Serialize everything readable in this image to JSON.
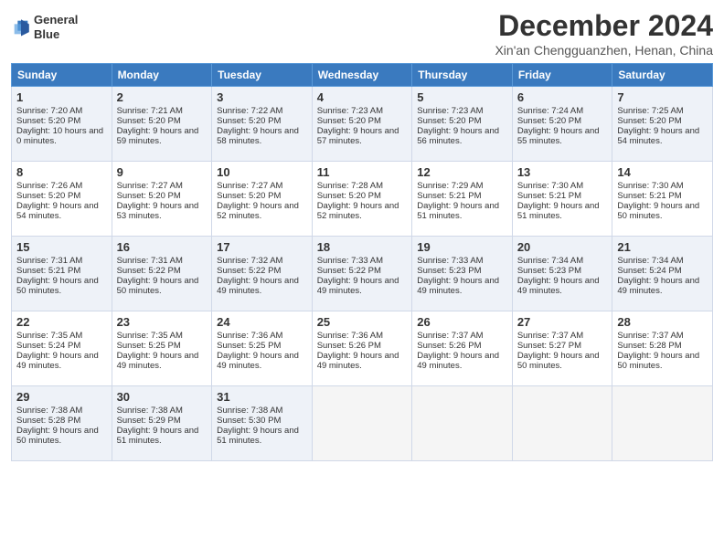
{
  "header": {
    "logo_line1": "General",
    "logo_line2": "Blue",
    "month": "December 2024",
    "location": "Xin'an Chengguanzhen, Henan, China"
  },
  "days_of_week": [
    "Sunday",
    "Monday",
    "Tuesday",
    "Wednesday",
    "Thursday",
    "Friday",
    "Saturday"
  ],
  "weeks": [
    [
      {
        "day": "1",
        "sunrise": "7:20 AM",
        "sunset": "5:20 PM",
        "daylight": "10 hours and 0 minutes."
      },
      {
        "day": "2",
        "sunrise": "7:21 AM",
        "sunset": "5:20 PM",
        "daylight": "9 hours and 59 minutes."
      },
      {
        "day": "3",
        "sunrise": "7:22 AM",
        "sunset": "5:20 PM",
        "daylight": "9 hours and 58 minutes."
      },
      {
        "day": "4",
        "sunrise": "7:23 AM",
        "sunset": "5:20 PM",
        "daylight": "9 hours and 57 minutes."
      },
      {
        "day": "5",
        "sunrise": "7:23 AM",
        "sunset": "5:20 PM",
        "daylight": "9 hours and 56 minutes."
      },
      {
        "day": "6",
        "sunrise": "7:24 AM",
        "sunset": "5:20 PM",
        "daylight": "9 hours and 55 minutes."
      },
      {
        "day": "7",
        "sunrise": "7:25 AM",
        "sunset": "5:20 PM",
        "daylight": "9 hours and 54 minutes."
      }
    ],
    [
      {
        "day": "8",
        "sunrise": "7:26 AM",
        "sunset": "5:20 PM",
        "daylight": "9 hours and 54 minutes."
      },
      {
        "day": "9",
        "sunrise": "7:27 AM",
        "sunset": "5:20 PM",
        "daylight": "9 hours and 53 minutes."
      },
      {
        "day": "10",
        "sunrise": "7:27 AM",
        "sunset": "5:20 PM",
        "daylight": "9 hours and 52 minutes."
      },
      {
        "day": "11",
        "sunrise": "7:28 AM",
        "sunset": "5:20 PM",
        "daylight": "9 hours and 52 minutes."
      },
      {
        "day": "12",
        "sunrise": "7:29 AM",
        "sunset": "5:21 PM",
        "daylight": "9 hours and 51 minutes."
      },
      {
        "day": "13",
        "sunrise": "7:30 AM",
        "sunset": "5:21 PM",
        "daylight": "9 hours and 51 minutes."
      },
      {
        "day": "14",
        "sunrise": "7:30 AM",
        "sunset": "5:21 PM",
        "daylight": "9 hours and 50 minutes."
      }
    ],
    [
      {
        "day": "15",
        "sunrise": "7:31 AM",
        "sunset": "5:21 PM",
        "daylight": "9 hours and 50 minutes."
      },
      {
        "day": "16",
        "sunrise": "7:31 AM",
        "sunset": "5:22 PM",
        "daylight": "9 hours and 50 minutes."
      },
      {
        "day": "17",
        "sunrise": "7:32 AM",
        "sunset": "5:22 PM",
        "daylight": "9 hours and 49 minutes."
      },
      {
        "day": "18",
        "sunrise": "7:33 AM",
        "sunset": "5:22 PM",
        "daylight": "9 hours and 49 minutes."
      },
      {
        "day": "19",
        "sunrise": "7:33 AM",
        "sunset": "5:23 PM",
        "daylight": "9 hours and 49 minutes."
      },
      {
        "day": "20",
        "sunrise": "7:34 AM",
        "sunset": "5:23 PM",
        "daylight": "9 hours and 49 minutes."
      },
      {
        "day": "21",
        "sunrise": "7:34 AM",
        "sunset": "5:24 PM",
        "daylight": "9 hours and 49 minutes."
      }
    ],
    [
      {
        "day": "22",
        "sunrise": "7:35 AM",
        "sunset": "5:24 PM",
        "daylight": "9 hours and 49 minutes."
      },
      {
        "day": "23",
        "sunrise": "7:35 AM",
        "sunset": "5:25 PM",
        "daylight": "9 hours and 49 minutes."
      },
      {
        "day": "24",
        "sunrise": "7:36 AM",
        "sunset": "5:25 PM",
        "daylight": "9 hours and 49 minutes."
      },
      {
        "day": "25",
        "sunrise": "7:36 AM",
        "sunset": "5:26 PM",
        "daylight": "9 hours and 49 minutes."
      },
      {
        "day": "26",
        "sunrise": "7:37 AM",
        "sunset": "5:26 PM",
        "daylight": "9 hours and 49 minutes."
      },
      {
        "day": "27",
        "sunrise": "7:37 AM",
        "sunset": "5:27 PM",
        "daylight": "9 hours and 50 minutes."
      },
      {
        "day": "28",
        "sunrise": "7:37 AM",
        "sunset": "5:28 PM",
        "daylight": "9 hours and 50 minutes."
      }
    ],
    [
      {
        "day": "29",
        "sunrise": "7:38 AM",
        "sunset": "5:28 PM",
        "daylight": "9 hours and 50 minutes."
      },
      {
        "day": "30",
        "sunrise": "7:38 AM",
        "sunset": "5:29 PM",
        "daylight": "9 hours and 51 minutes."
      },
      {
        "day": "31",
        "sunrise": "7:38 AM",
        "sunset": "5:30 PM",
        "daylight": "9 hours and 51 minutes."
      },
      null,
      null,
      null,
      null
    ]
  ],
  "labels": {
    "sunrise": "Sunrise:",
    "sunset": "Sunset:",
    "daylight": "Daylight:"
  }
}
